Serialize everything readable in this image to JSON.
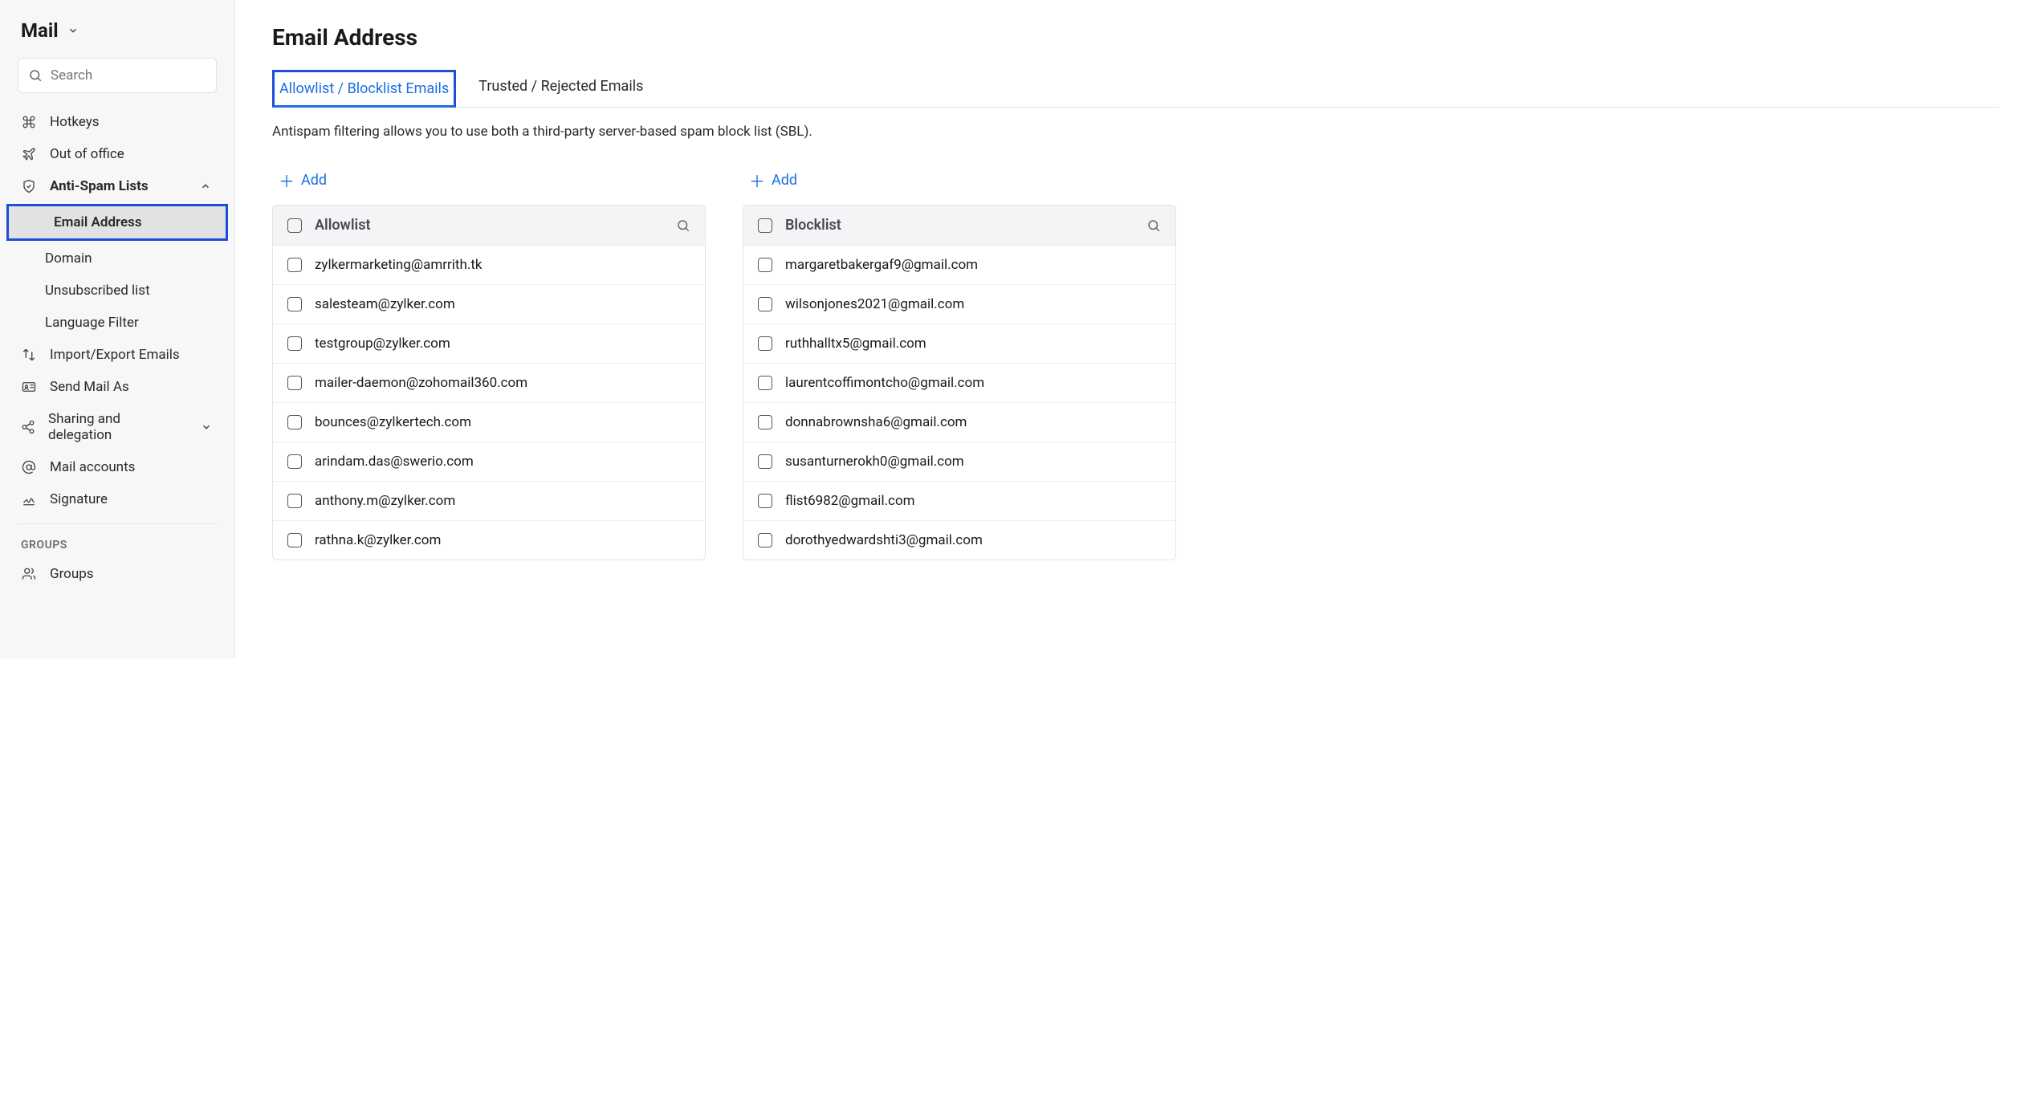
{
  "sidebar": {
    "app_label": "Mail",
    "search_placeholder": "Search",
    "items": [
      {
        "label": "Hotkeys"
      },
      {
        "label": "Out of office"
      },
      {
        "label": "Anti-Spam Lists"
      },
      {
        "label": "Import/Export Emails"
      },
      {
        "label": "Send Mail As"
      },
      {
        "label": "Sharing and delegation"
      },
      {
        "label": "Mail accounts"
      },
      {
        "label": "Signature"
      }
    ],
    "subitems": [
      {
        "label": "Email Address"
      },
      {
        "label": "Domain"
      },
      {
        "label": "Unsubscribed list"
      },
      {
        "label": "Language Filter"
      }
    ],
    "groups_label": "GROUPS",
    "groups_item": "Groups"
  },
  "main": {
    "title": "Email Address",
    "tabs": [
      {
        "label": "Allowlist / Blocklist Emails"
      },
      {
        "label": "Trusted / Rejected Emails"
      }
    ],
    "description": "Antispam filtering allows you to use both a third-party server-based spam block list (SBL).",
    "add_label": "Add",
    "allowlist": {
      "title": "Allowlist",
      "rows": [
        "zylkermarketing@amrrith.tk",
        "salesteam@zylker.com",
        "testgroup@zylker.com",
        "mailer-daemon@zohomail360.com",
        "bounces@zylkertech.com",
        "arindam.das@swerio.com",
        "anthony.m@zylker.com",
        "rathna.k@zylker.com"
      ]
    },
    "blocklist": {
      "title": "Blocklist",
      "rows": [
        "margaretbakergaf9@gmail.com",
        "wilsonjones2021@gmail.com",
        "ruthhalltx5@gmail.com",
        "laurentcoffimontcho@gmail.com",
        "donnabrownsha6@gmail.com",
        "susanturnerokh0@gmail.com",
        "flist6982@gmail.com",
        "dorothyedwardshti3@gmail.com"
      ]
    }
  }
}
